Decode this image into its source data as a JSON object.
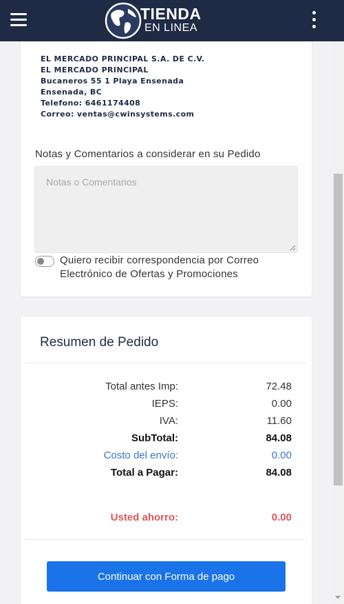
{
  "header": {
    "menu_icon": "hamburger-menu-icon",
    "logo_line1": "TIENDA",
    "logo_line2": "EN LINEA",
    "more_icon": "kebab-menu-icon",
    "bg_color": "#1f2a44"
  },
  "store": {
    "lines": [
      "EL MERCADO PRINCIPAL S.A. DE C.V.",
      "EL MERCADO PRINCIPAL",
      "Bucaneros 55 1 Playa Ensenada",
      "Ensenada, BC",
      "Telefono: 6461174408",
      "Correo: ventas@cwinsystems.com"
    ]
  },
  "notes": {
    "title": "Notas y Comentarios a considerar en su Pedido",
    "placeholder": "Notas o Comentarios",
    "value": ""
  },
  "newsletter": {
    "label": "Quiero recibir correspondencia por Correo Electrónico de Ofertas y Promociones",
    "checked": false
  },
  "summary": {
    "title": "Resumen de Pedido",
    "rows": [
      {
        "label": "Total antes Imp:",
        "value": "72.48"
      },
      {
        "label": "IEPS:",
        "value": "0.00"
      },
      {
        "label": "IVA:",
        "value": "11.60"
      },
      {
        "label": "SubTotal:",
        "value": "84.08"
      },
      {
        "label": "Costo del envío:",
        "value": "0.00"
      },
      {
        "label": "Total a Pagar:",
        "value": "84.08"
      }
    ],
    "savings": {
      "label": "Usted ahorro:",
      "value": "0.00"
    },
    "cta_label": "Continuar con Forma de pago"
  },
  "colors": {
    "accent": "#1a73e8",
    "link": "#3b75c4",
    "savings": "#e0555c"
  }
}
